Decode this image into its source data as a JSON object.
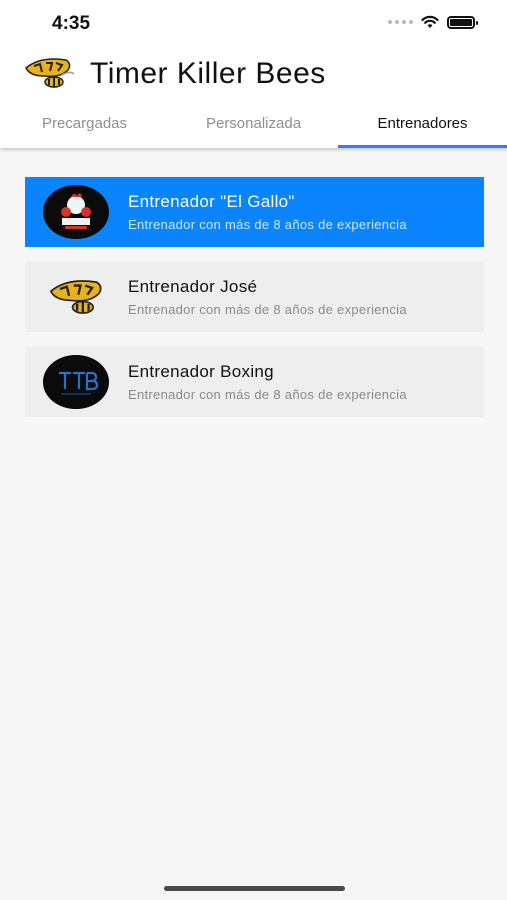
{
  "status_bar": {
    "time": "4:35"
  },
  "app": {
    "title": "Timer Killer Bees"
  },
  "tabs": [
    {
      "label": "Precargadas",
      "active": false
    },
    {
      "label": "Personalizada",
      "active": false
    },
    {
      "label": "Entrenadores",
      "active": true
    }
  ],
  "trainers": [
    {
      "name": "Entrenador \"El Gallo\"",
      "description": "Entrenador con más de 8 años de experiencia",
      "selected": true,
      "avatar_icon": "club-gallos-logo-icon"
    },
    {
      "name": "Entrenador José",
      "description": "Entrenador con más de 8 años de experiencia",
      "selected": false,
      "avatar_icon": "killer-bees-logo-icon"
    },
    {
      "name": "Entrenador Boxing",
      "description": "Entrenador con más de 8 años de experiencia",
      "selected": false,
      "avatar_icon": "ttb-logo-icon"
    }
  ],
  "colors": {
    "accent": "#0a84ff",
    "tab_indicator": "#2f80ed",
    "card_bg": "#eeeeee"
  }
}
